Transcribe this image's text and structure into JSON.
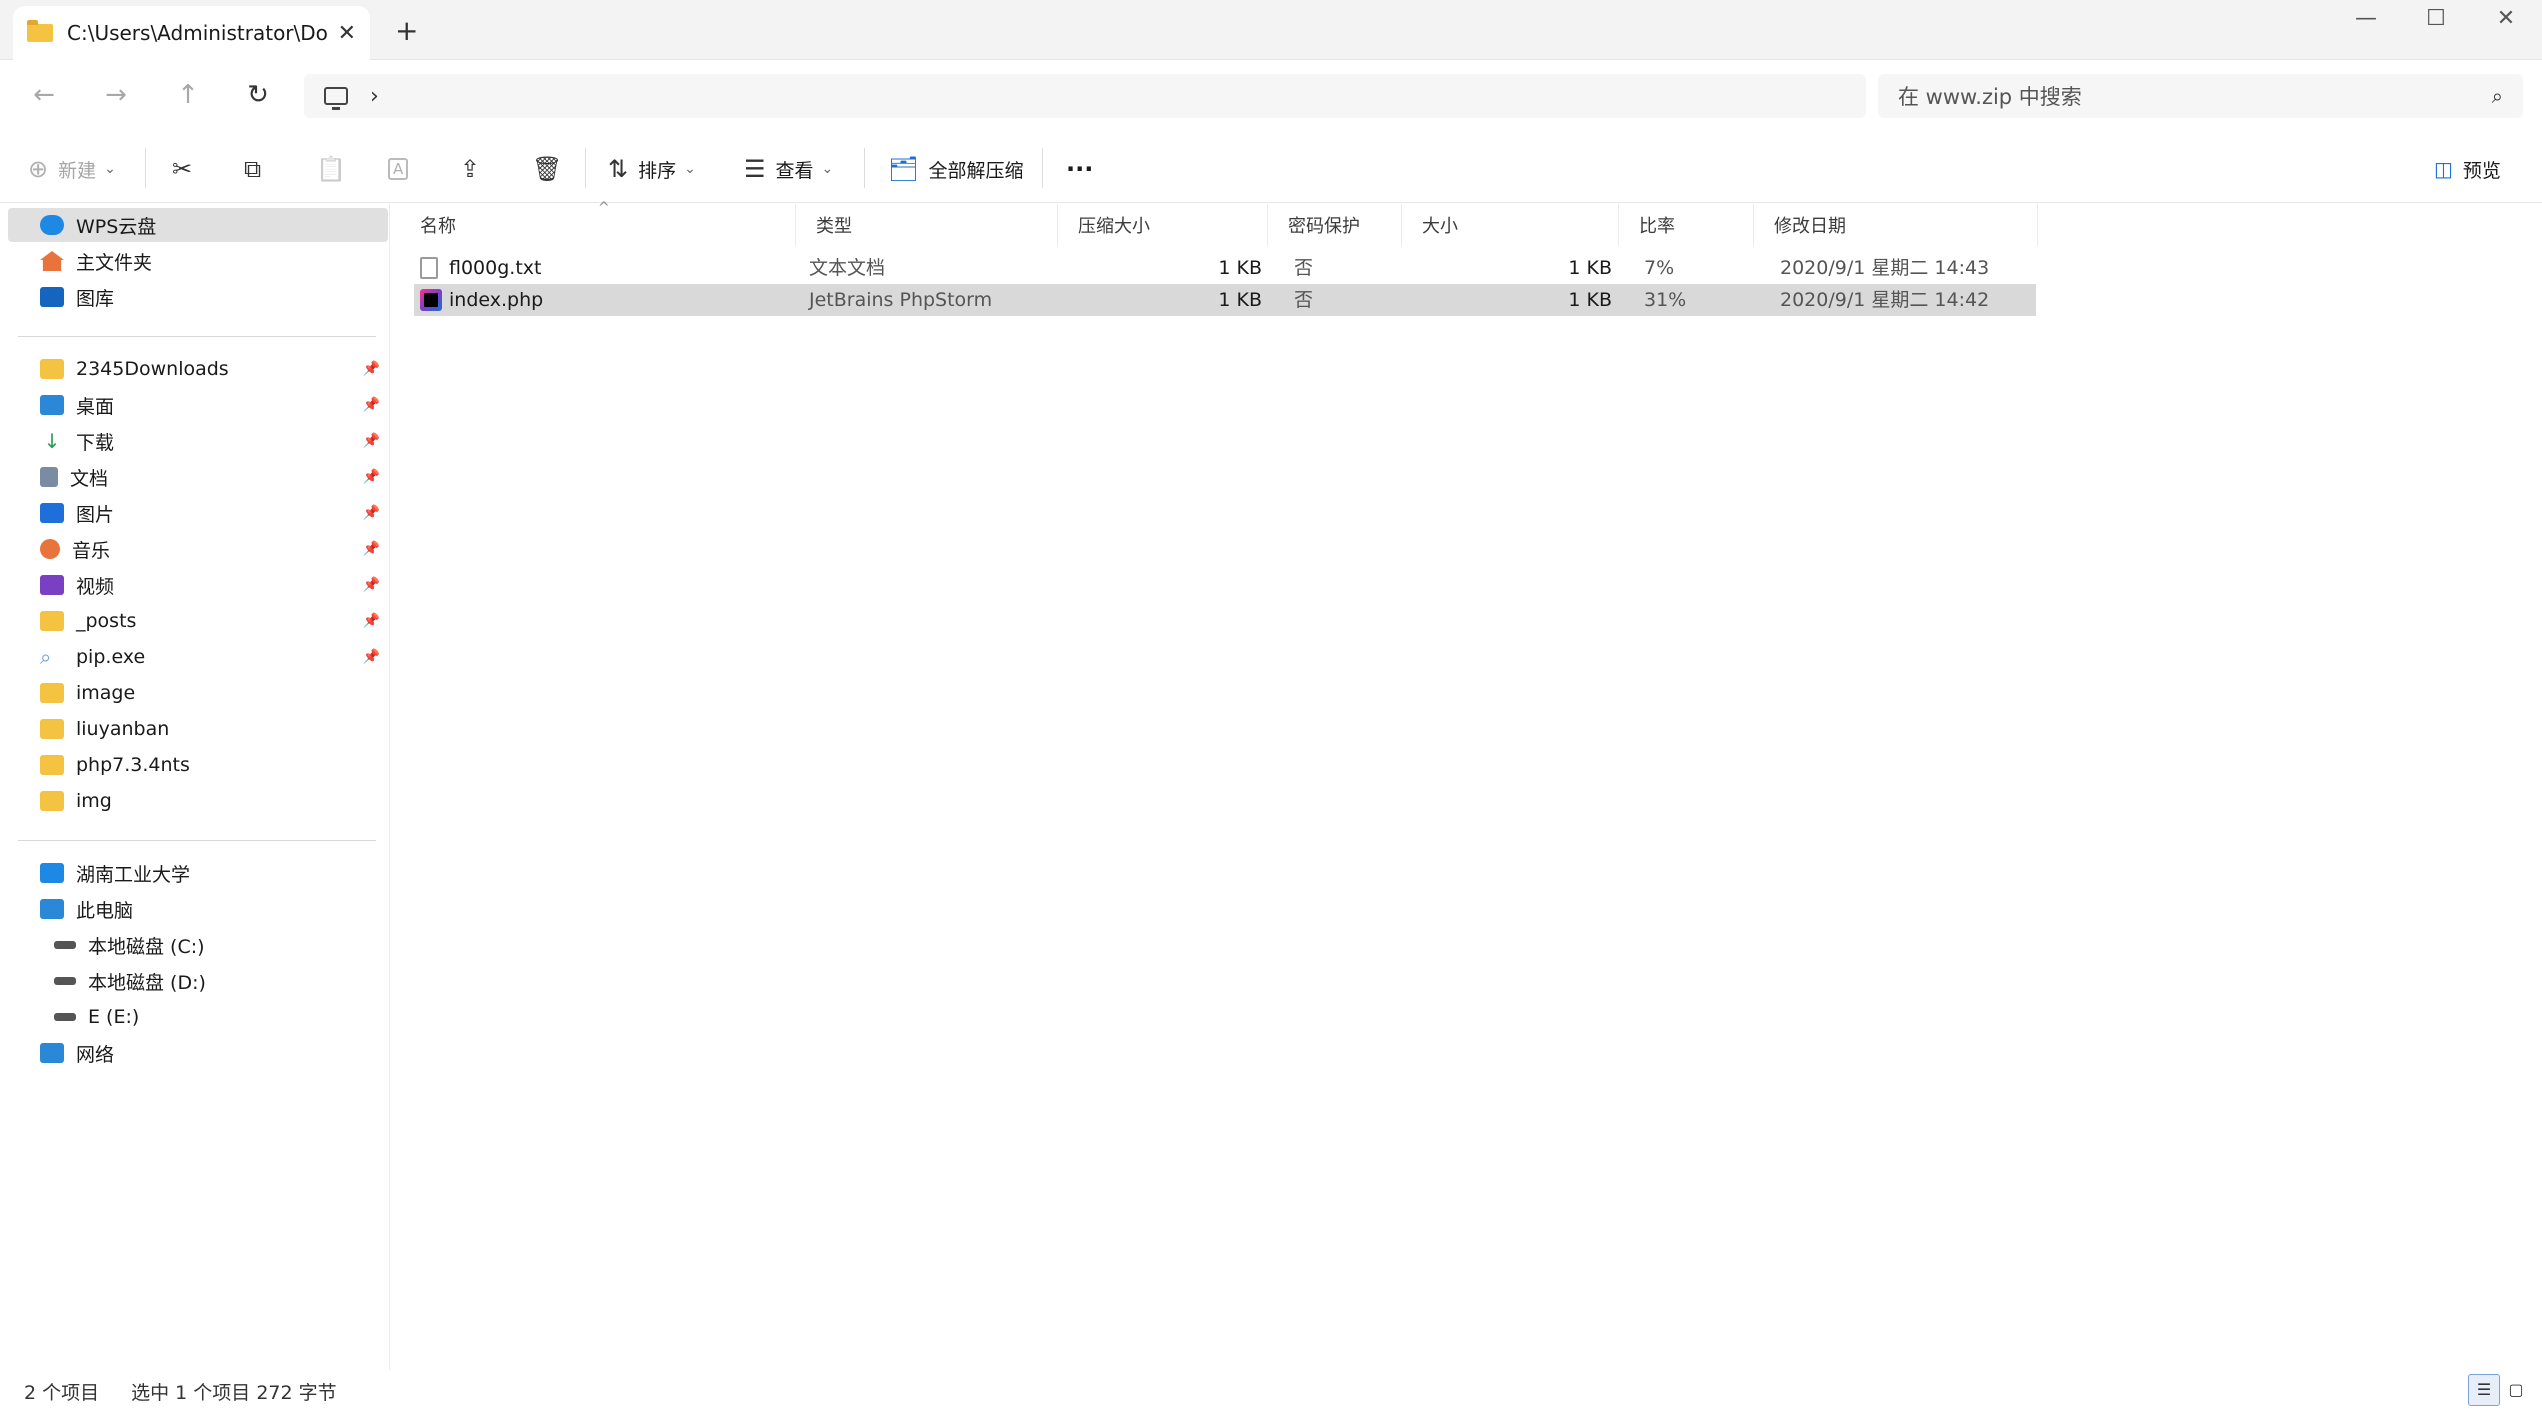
{
  "tab": {
    "title": "C:\\Users\\Administrator\\Downl",
    "close": "✕",
    "new": "+"
  },
  "window": {
    "minimize": "—",
    "maximize": "☐",
    "close": "✕"
  },
  "nav": {
    "back": "←",
    "forward": "→",
    "up": "↑",
    "refresh": "↻",
    "chevron": "›"
  },
  "search": {
    "placeholder": "在 www.zip 中搜索",
    "icon": "⌕"
  },
  "commands": {
    "new": "新建",
    "cut_icon": "✂",
    "copy_icon": "⧉",
    "paste_icon": "📋",
    "rename_icon": "A",
    "share_icon": "⇪",
    "delete_icon": "🗑",
    "sort": "排序",
    "view": "查看",
    "extract_all": "全部解压缩",
    "more": "···",
    "preview": "预览"
  },
  "sidebar": {
    "top": [
      {
        "label": "WPS云盘",
        "icon": "cloud-icon",
        "color": "#1e88e5"
      },
      {
        "label": "主文件夹",
        "icon": "home-icon",
        "color": "#e8743b"
      },
      {
        "label": "图库",
        "icon": "gallery-icon",
        "color": "#1565c0"
      }
    ],
    "quick": [
      {
        "label": "2345Downloads",
        "icon": "folder-icon",
        "color": "#f4c342"
      },
      {
        "label": "桌面",
        "icon": "desktop-icon",
        "color": "#2b88d8"
      },
      {
        "label": "下载",
        "icon": "download-icon",
        "color": "#2a9d5b"
      },
      {
        "label": "文档",
        "icon": "documents-icon",
        "color": "#7a8ca3"
      },
      {
        "label": "图片",
        "icon": "pictures-icon",
        "color": "#1e6fd9"
      },
      {
        "label": "音乐",
        "icon": "music-icon",
        "color": "#e8743b"
      },
      {
        "label": "视频",
        "icon": "videos-icon",
        "color": "#7b3fc4"
      },
      {
        "label": "_posts",
        "icon": "folder-icon",
        "color": "#f4c342"
      },
      {
        "label": "pip.exe",
        "icon": "search-file-icon",
        "color": "#6a9fd8"
      },
      {
        "label": "image",
        "icon": "folder-icon",
        "color": "#f4c342"
      },
      {
        "label": "liuyanban",
        "icon": "folder-icon",
        "color": "#f4c342"
      },
      {
        "label": "php7.3.4nts",
        "icon": "folder-icon",
        "color": "#f4c342"
      },
      {
        "label": "img",
        "icon": "folder-icon",
        "color": "#f4c342"
      }
    ],
    "pin_glyph": "📌",
    "devices": [
      {
        "label": "湖南工业大学",
        "icon": "building-icon",
        "color": "#1e88e5"
      },
      {
        "label": "此电脑",
        "icon": "pc-icon",
        "color": "#2b88d8"
      },
      {
        "label": "本地磁盘 (C:)",
        "icon": "drive-c-icon",
        "color": "#555555"
      },
      {
        "label": "本地磁盘 (D:)",
        "icon": "drive-icon",
        "color": "#555555"
      },
      {
        "label": "E (E:)",
        "icon": "drive-icon",
        "color": "#555555"
      },
      {
        "label": "网络",
        "icon": "network-icon",
        "color": "#2b88d8"
      }
    ]
  },
  "columns": {
    "name": "名称",
    "type": "类型",
    "compressed": "压缩大小",
    "password": "密码保护",
    "size": "大小",
    "ratio": "比率",
    "modified": "修改日期",
    "sort_caret": "^"
  },
  "files": [
    {
      "name": "fl000g.txt",
      "type": "文本文档",
      "compressed": "1 KB",
      "password": "否",
      "size": "1 KB",
      "ratio": "7%",
      "modified": "2020/9/1 星期二 14:43",
      "icon": "text-file-icon",
      "selected": false
    },
    {
      "name": "index.php",
      "type": "JetBrains PhpStorm",
      "compressed": "1 KB",
      "password": "否",
      "size": "1 KB",
      "ratio": "31%",
      "modified": "2020/9/1 星期二 14:42",
      "icon": "phpstorm-file-icon",
      "selected": true
    }
  ],
  "status": {
    "count": "2 个项目",
    "selection": "选中 1 个项目  272 字节"
  },
  "colors": {
    "selection": "#d9d9d9",
    "sidebar_selected": "#e0e0e0",
    "accent": "#0067c0"
  }
}
